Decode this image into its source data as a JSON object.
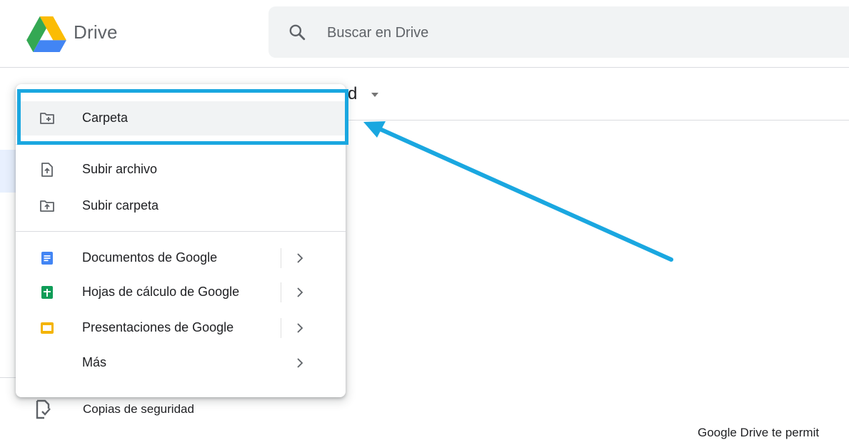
{
  "header": {
    "app_name": "Drive",
    "logo_icon": "google-drive-logo",
    "search_icon": "search-icon",
    "search_placeholder": "Buscar en Drive"
  },
  "background": {
    "title_peek": "d",
    "backup_label": "Copias de seguridad",
    "footer_peek": "Google Drive te permit"
  },
  "menu": {
    "items": [
      {
        "label": "Carpeta",
        "icon": "new-folder-icon",
        "hover": true
      },
      {
        "label": "Subir archivo",
        "icon": "file-upload-icon"
      },
      {
        "label": "Subir carpeta",
        "icon": "folder-upload-icon"
      },
      {
        "label": "Documentos de Google",
        "icon": "google-docs-icon",
        "submenu": true
      },
      {
        "label": "Hojas de cálculo de Google",
        "icon": "google-sheets-icon",
        "submenu": true
      },
      {
        "label": "Presentaciones de Google",
        "icon": "google-slides-icon",
        "submenu": true
      },
      {
        "label": "Más",
        "submenu": true
      }
    ]
  },
  "colors": {
    "annotation": "#1aa7e0",
    "docs": "#4285f4",
    "sheets": "#0f9d58",
    "slides": "#f4b400",
    "hover": "#f1f3f4"
  }
}
